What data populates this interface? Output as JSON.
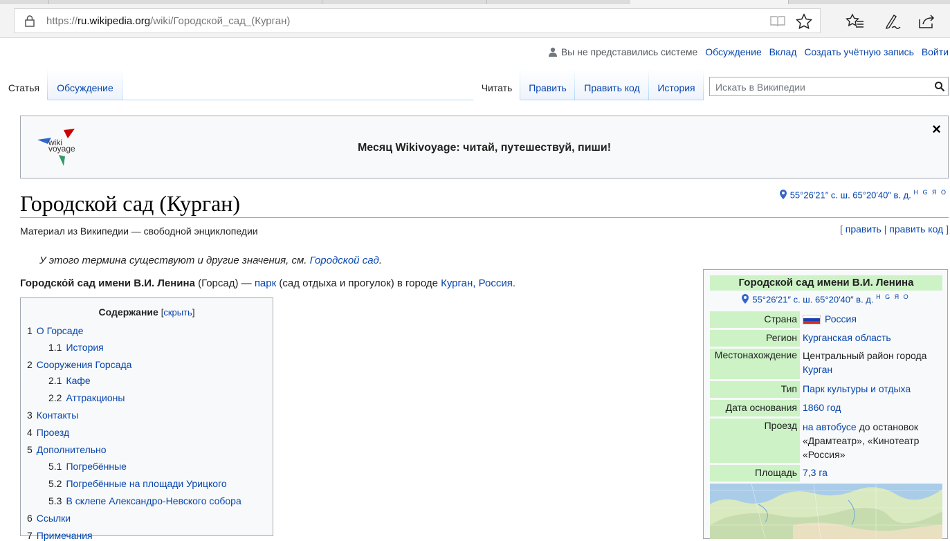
{
  "browser": {
    "url_prefix": "https://",
    "url_host": "ru.wikipedia.org",
    "url_path": "/wiki/Городской_сад_(Курган)"
  },
  "personal": {
    "anon": "Вы не представились системе",
    "talk": "Обсуждение",
    "contrib": "Вклад",
    "create": "Создать учётную запись",
    "login": "Войти"
  },
  "tabs": {
    "article": "Статья",
    "discussion": "Обсуждение",
    "read": "Читать",
    "edit": "Править",
    "edit_source": "Править код",
    "history": "История"
  },
  "search": {
    "placeholder": "Искать в Википедии"
  },
  "banner": {
    "message": "Месяц Wikivoyage: читай, путешествуй, пиши!",
    "close": "×",
    "logo_line1": "wiki",
    "logo_line2": "voyage"
  },
  "page": {
    "title": "Городской сад (Курган)",
    "coords": "55°26′21″ с. ш. 65°20′40″ в. д.",
    "coord_links": "Н G Я O",
    "tagline": "Материал из Википедии — свободной энциклопедии",
    "edit_open": "[",
    "edit_link": "править",
    "edit_sep": "|",
    "edit_code_link": "править код",
    "edit_close": "]",
    "hatnote_text": "У этого термина существуют и другие значения, см.",
    "hatnote_link": "Городской сад",
    "hatnote_end": ".",
    "lead_bold": "Городско́й сад имени В.И. Ленина",
    "lead_part1": "(Горсад) —",
    "lead_link_park": "парк",
    "lead_part2": "(сад отдыха и прогулок) в городе",
    "lead_link_city": "Курган",
    "lead_comma": ",",
    "lead_link_country": "Россия",
    "lead_end": "."
  },
  "toc": {
    "title": "Содержание",
    "hide_open": "[",
    "hide": "скрыть",
    "hide_close": "]",
    "items": [
      {
        "num": "1",
        "label": "О Горсаде"
      },
      {
        "num": "1.1",
        "label": "История"
      },
      {
        "num": "2",
        "label": "Сооружения Горсада"
      },
      {
        "num": "2.1",
        "label": "Кафе"
      },
      {
        "num": "2.2",
        "label": "Аттракционы"
      },
      {
        "num": "3",
        "label": "Контакты"
      },
      {
        "num": "4",
        "label": "Проезд"
      },
      {
        "num": "5",
        "label": "Дополнительно"
      },
      {
        "num": "5.1",
        "label": "Погребённые"
      },
      {
        "num": "5.2",
        "label": "Погребённые на площади Урицкого"
      },
      {
        "num": "5.3",
        "label": "В склепе Александро-Невского собора"
      },
      {
        "num": "6",
        "label": "Ссылки"
      },
      {
        "num": "7",
        "label": "Примечания"
      }
    ]
  },
  "infobox": {
    "title": "Городской сад имени В.И. Ленина",
    "coords": "55°26′21″ с. ш. 65°20′40″ в. д.",
    "coord_links": "Н G Я O",
    "rows": {
      "country_label": "Страна",
      "country_value": "Россия",
      "region_label": "Регион",
      "region_value": "Курганская область",
      "location_label": "Местонахождение",
      "location_text": "Центральный район города",
      "location_link": "Курган",
      "type_label": "Тип",
      "type_value": "Парк культуры и отдыха",
      "founded_label": "Дата основания",
      "founded_value": "1860 год",
      "transit_label": "Проезд",
      "transit_link": "на автобусе",
      "transit_text1": "до остановок",
      "transit_text2": "«Драмтеатр», «Кинотеатр",
      "transit_text3": "«Россия»",
      "area_label": "Площадь",
      "area_value": "7,3 га"
    }
  },
  "colors": {
    "link": "#0645ad",
    "infobox_header": "#ccf2c5",
    "border": "#a2a9b1"
  }
}
